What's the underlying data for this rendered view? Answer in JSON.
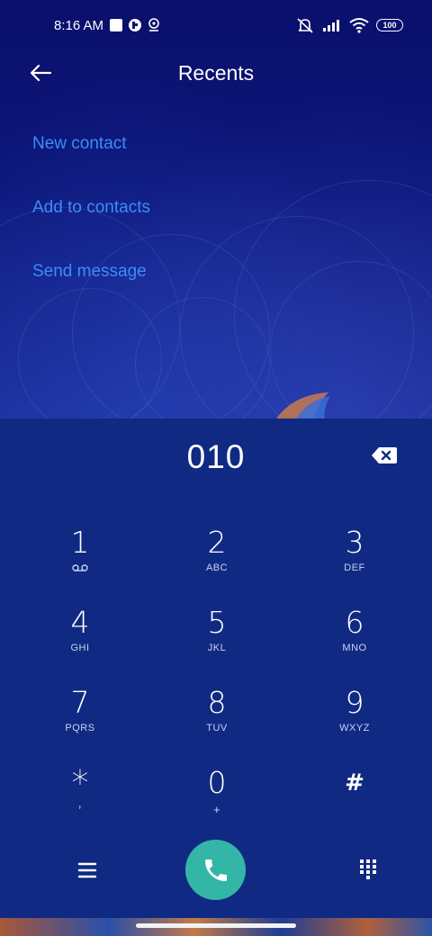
{
  "status_bar": {
    "time": "8:16 AM",
    "battery": "100",
    "icons": [
      "square-notification-icon",
      "app-notification-icon",
      "location-icon",
      "mute-icon",
      "signal-icon",
      "wifi-icon",
      "battery-icon"
    ]
  },
  "header": {
    "title": "Recents",
    "back_icon": "arrow-left-icon"
  },
  "actions": [
    {
      "label": "New contact"
    },
    {
      "label": "Add to contacts"
    },
    {
      "label": "Send message"
    }
  ],
  "dialpad": {
    "number": "010",
    "keys": [
      {
        "digit": "1",
        "letters": "",
        "icon": "voicemail-icon"
      },
      {
        "digit": "2",
        "letters": "ABC"
      },
      {
        "digit": "3",
        "letters": "DEF"
      },
      {
        "digit": "4",
        "letters": "GHI"
      },
      {
        "digit": "5",
        "letters": "JKL"
      },
      {
        "digit": "6",
        "letters": "MNO"
      },
      {
        "digit": "7",
        "letters": "PQRS"
      },
      {
        "digit": "8",
        "letters": "TUV"
      },
      {
        "digit": "9",
        "letters": "WXYZ"
      },
      {
        "digit": "*",
        "letters": ","
      },
      {
        "digit": "0",
        "letters": "+"
      },
      {
        "digit": "#",
        "letters": ""
      }
    ]
  },
  "colors": {
    "accent_link": "#3d8cf5",
    "call_button": "#33b6a6",
    "dialpad_bg": "#102a83"
  }
}
